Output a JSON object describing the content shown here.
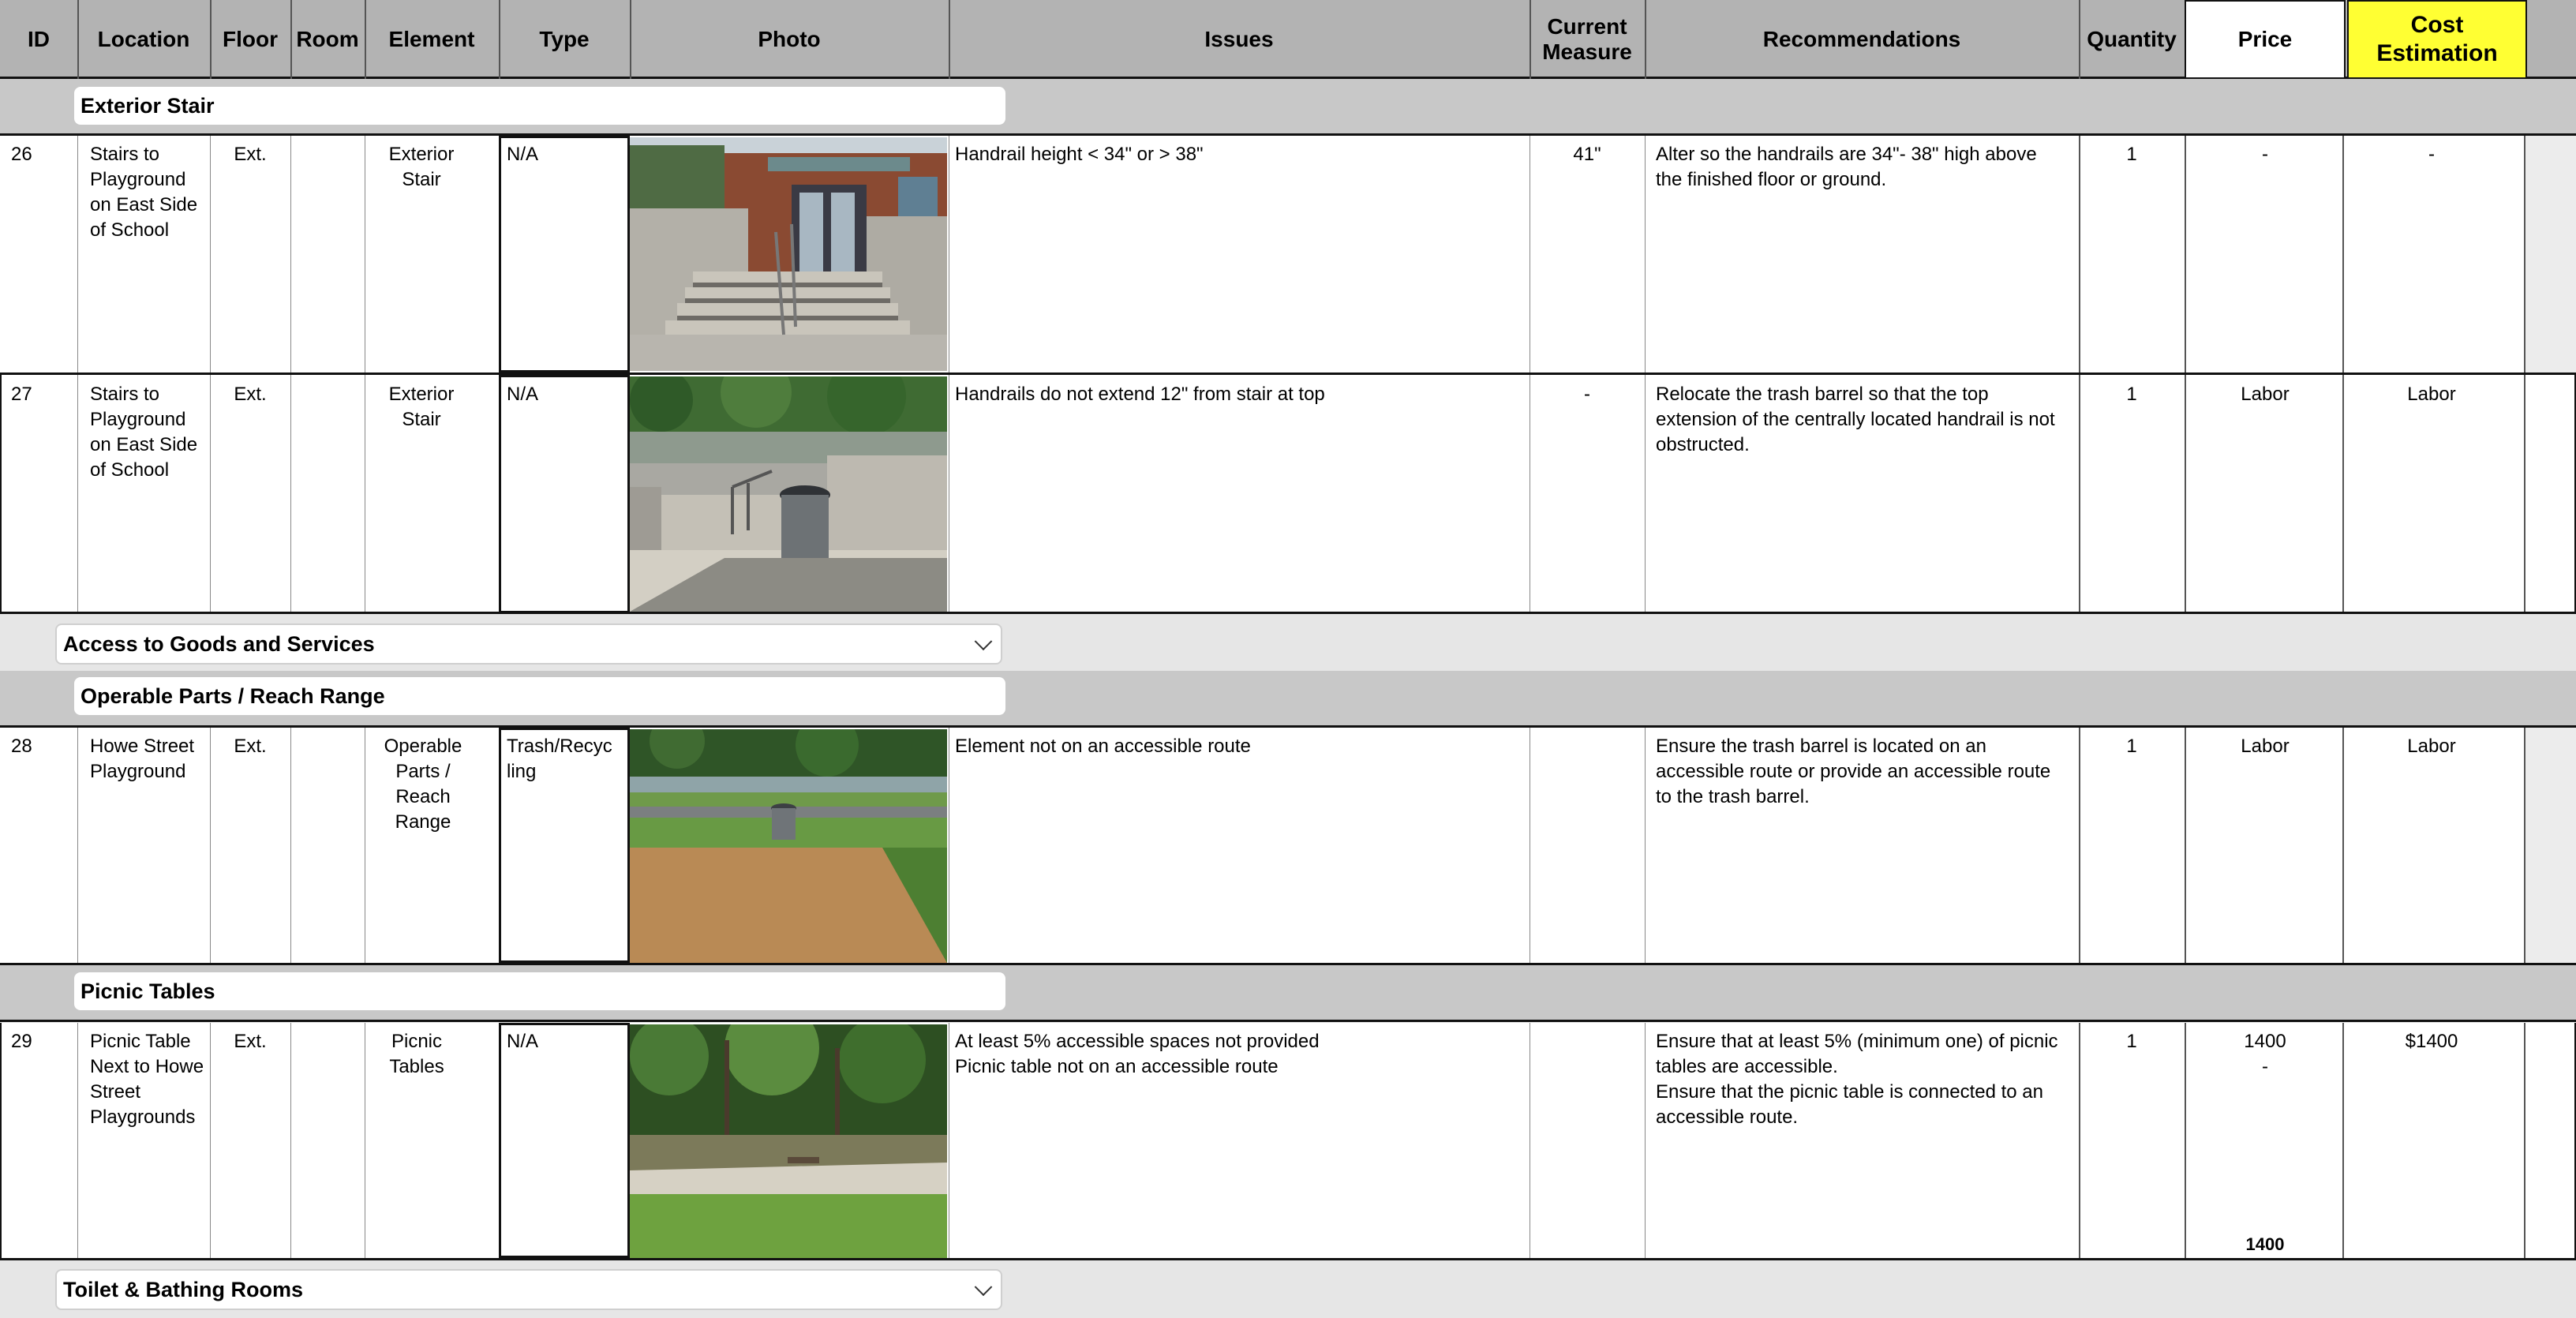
{
  "header": {
    "id": "ID",
    "location": "Location",
    "floor": "Floor",
    "room": "Room",
    "element": "Element",
    "type": "Type",
    "photo": "Photo",
    "issues": "Issues",
    "current_measure": "Current\nMeasure",
    "recommendations": "Recommendations",
    "quantity": "Quantity",
    "price": "Price",
    "cost_estimation": "Cost\nEstimation"
  },
  "sections": {
    "exterior_stair": "Exterior Stair",
    "access_goods": "Access to Goods and Services",
    "operable_parts": "Operable Parts / Reach Range",
    "picnic_tables": "Picnic Tables",
    "toilet_bathing": "Toilet & Bathing Rooms"
  },
  "rows": [
    {
      "id": "26",
      "location": "Stairs to\nPlayground\non East Side\nof School",
      "floor": "Ext.",
      "room": "",
      "element": "Exterior\nStair",
      "type": "N/A",
      "issues": "Handrail height < 34\" or > 38\"",
      "current_measure": "41\"",
      "recommendations": "Alter so the handrails are 34\"- 38\" high above\nthe finished floor or ground.",
      "quantity": "1",
      "price": "-",
      "cost": "-"
    },
    {
      "id": "27",
      "location": "Stairs to\nPlayground\non East Side\nof School",
      "floor": "Ext.",
      "room": "",
      "element": "Exterior\nStair",
      "type": "N/A",
      "issues": "Handrails do not extend 12\" from stair at top",
      "current_measure": "-",
      "recommendations": "Relocate the trash barrel so that the top\nextension of the centrally located handrail is not\nobstructed.",
      "quantity": "1",
      "price": "Labor",
      "cost": "Labor"
    },
    {
      "id": "28",
      "location": "Howe Street\nPlayground",
      "floor": "Ext.",
      "room": "",
      "element": "Operable\nParts /\nReach\nRange",
      "type": "Trash/Recyc\nling",
      "issues": "Element not on an accessible route",
      "current_measure": "",
      "recommendations": "Ensure the trash barrel is located on an\naccessible route or provide an accessible route\nto the trash barrel.",
      "quantity": "1",
      "price": "Labor",
      "cost": "Labor"
    },
    {
      "id": "29",
      "location": "Picnic Table\nNext to Howe\nStreet\nPlaygrounds",
      "floor": "Ext.",
      "room": "",
      "element": "Picnic\nTables",
      "type": "N/A",
      "issues": "At least 5% accessible spaces not provided\nPicnic table not on an accessible route",
      "current_measure": "",
      "recommendations": "Ensure that at least 5% (minimum one) of picnic\ntables are accessible.\nEnsure that the picnic table is connected to an\naccessible route.",
      "quantity": "1",
      "price": "1400\n-",
      "price_total": "1400",
      "cost": "$1400"
    }
  ],
  "colors": {
    "header_bg": "#b3b3b3",
    "cost_header_bg": "#ffff33",
    "section_dark": "#c8c8c8",
    "section_light": "#e6e6e6"
  }
}
